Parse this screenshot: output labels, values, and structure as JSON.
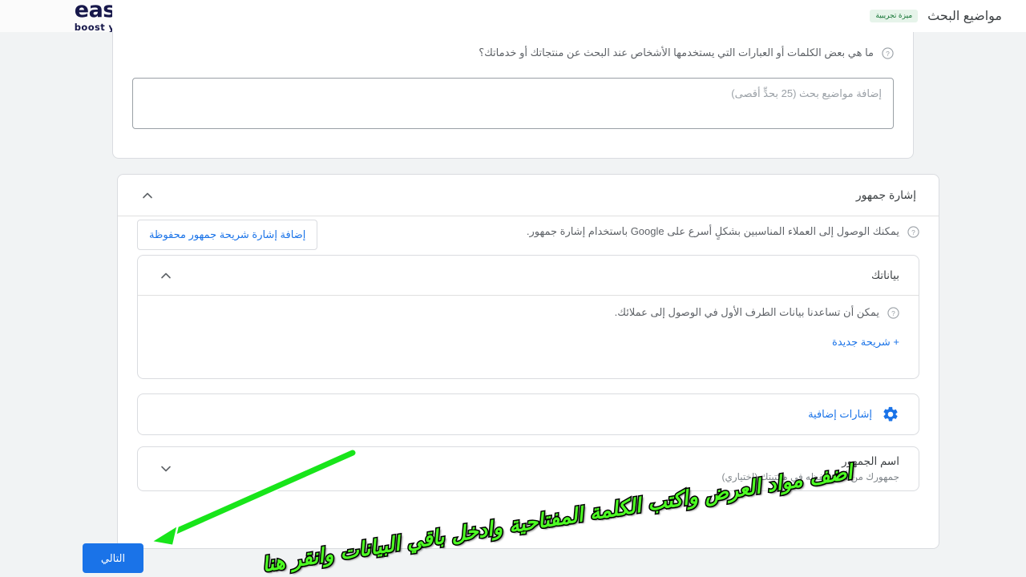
{
  "brand": {
    "name": "easy orders",
    "tagline": "boost your sales",
    "logo_icon": "easyorders-logo-icon"
  },
  "header": {
    "title": "مواضيع البحث",
    "badge": "ميزة تجريبية"
  },
  "search_themes": {
    "question": "ما هي بعض الكلمات أو العبارات التي يستخدمها الأشخاص عند البحث عن منتجاتك أو خدماتك؟",
    "help_icon": "help-circle-icon",
    "input_placeholder": "إضافة مواضيع بحث (25 بحدٍّ أقصى)",
    "input_value": ""
  },
  "audience_signal": {
    "section_title": "إشارة جمهور",
    "collapse_icon": "chevron-up-icon",
    "description": "يمكنك الوصول إلى العملاء المناسبين بشكلٍ أسرع على Google باستخدام إشارة جمهور.",
    "help_icon": "help-circle-icon",
    "add_saved_button": "إضافة إشارة شريحة جمهور محفوظة",
    "your_data": {
      "title": "بياناتك",
      "collapse_icon": "chevron-up-icon",
      "description": "يمكن أن تساعدنا بيانات الطرف الأول في الوصول إلى عملائك.",
      "help_icon": "help-circle-icon",
      "new_segment_link": "+ شريحة جديدة"
    },
    "extra_signals": {
      "label": "إشارات إضافية",
      "icon": "gear-icon"
    },
    "audience_name": {
      "title": "اسم الجمهور",
      "subtitle": "جمهورك من أجل حفظه في مكتبتك (اختياري)",
      "expand_icon": "chevron-down-icon"
    }
  },
  "footer": {
    "next_button": "التالي"
  },
  "annotations": {
    "instruction": "اضف مواد العرض واكتب الكلمة المفتاحية وادخل باقي البيانات وانقر هنا",
    "arrow_icon": "green-arrow-icon",
    "color": "#4dfd23"
  },
  "colors": {
    "accent_blue": "#1a73e8",
    "page_background": "#f1f3f4",
    "brand_navy": "#16174a",
    "brand_green": "#22c55e",
    "brand_orange": "#fbab18",
    "badge_green_bg": "#e6f4ea",
    "badge_green_text": "#137333",
    "annotation_green": "#4dfd23"
  }
}
